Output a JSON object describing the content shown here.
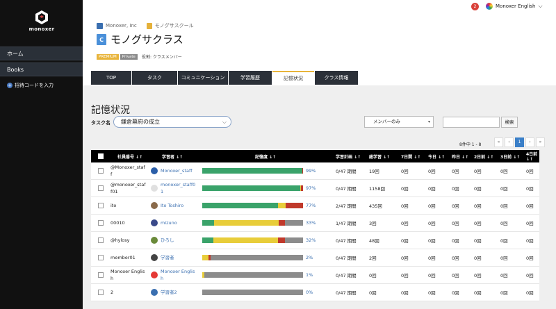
{
  "sidebar": {
    "logo_text": "monoxer",
    "items": [
      {
        "label": "ホーム"
      },
      {
        "label": "Books"
      }
    ],
    "invite_label": "招待コードを入力"
  },
  "topbar": {
    "notification_count": "2",
    "language_label": "Monoxer English"
  },
  "header": {
    "org_name": "Monoxer, Inc",
    "school_name": "モノグサスクール",
    "class_icon_letter": "C",
    "class_title": "モノグサクラス",
    "badge_premium": "PREMIUM",
    "badge_private": "Private",
    "role_text": "役割: クラスメンバー"
  },
  "tabs": [
    {
      "label": "TOP"
    },
    {
      "label": "タスク"
    },
    {
      "label": "コミュニケーション"
    },
    {
      "label": "学習履歴"
    },
    {
      "label": "記憶状況"
    },
    {
      "label": "クラス情報"
    }
  ],
  "active_tab_index": 4,
  "main": {
    "section_title": "記憶状況",
    "task_filter_label": "タスク名",
    "task_selected": "鎌倉幕府の成立",
    "member_filter": "メンバーのみ",
    "search_button": "検索",
    "pager_info": "8件中 1 - 8",
    "pager": [
      "«",
      "‹",
      "1",
      "›",
      "»"
    ]
  },
  "colors": {
    "green": "#3aa36a",
    "yellow": "#e8cd3a",
    "red": "#c0392b",
    "gray": "#8c8c8c",
    "link": "#3a6fb0",
    "accent": "#e8b43a"
  },
  "table": {
    "headers": [
      "社員番号 ↓↑",
      "学習者 ↓↑",
      "記憶度 ↓↑",
      "学習計画 ↓↑",
      "総学習 ↓↑",
      "7日間 ↓↑",
      "今日 ↓↑",
      "昨日 ↓↑",
      "2日前 ↓↑",
      "3日前 ↓↑",
      "4日前 ↓↑"
    ],
    "rows": [
      {
        "id": "@Monoxer_staf\nf",
        "learner": "Monoxer_staff",
        "avatar": "#2b5ea8",
        "mem": [
          99,
          0,
          1,
          0
        ],
        "pct": "99%",
        "plan": "0/47 期間",
        "total": "19回",
        "d7": "0回",
        "today": "0回",
        "yesterday": "0回",
        "d2": "0回",
        "d3": "0回",
        "d4": "0回"
      },
      {
        "id": "@monoxer_staf\nf01",
        "learner": "monoxer_staff0\n1",
        "avatar": "#e0e0e0",
        "mem": [
          97,
          1,
          2,
          0
        ],
        "pct": "97%",
        "plan": "0/47 期間",
        "total": "1158回",
        "d7": "0回",
        "today": "0回",
        "yesterday": "0回",
        "d2": "0回",
        "d3": "0回",
        "d4": "0回"
      },
      {
        "id": "ito",
        "learner": "Ito Toshiro",
        "avatar": "#8a6a4a",
        "mem": [
          75,
          8,
          17,
          0
        ],
        "pct": "77%",
        "plan": "2/47 期間",
        "total": "435回",
        "d7": "0回",
        "today": "0回",
        "yesterday": "0回",
        "d2": "0回",
        "d3": "0回",
        "d4": "0回"
      },
      {
        "id": "00010",
        "learner": "mizuno",
        "avatar": "#3a4a8a",
        "mem": [
          12,
          64,
          6,
          18
        ],
        "pct": "33%",
        "plan": "1/47 期間",
        "total": "3回",
        "d7": "0回",
        "today": "0回",
        "yesterday": "0回",
        "d2": "0回",
        "d3": "0回",
        "d4": "0回"
      },
      {
        "id": "@hylosy",
        "learner": "ひろし",
        "avatar": "#6a8a3a",
        "mem": [
          11,
          64,
          7,
          18
        ],
        "pct": "32%",
        "plan": "0/47 期間",
        "total": "48回",
        "d7": "0回",
        "today": "0回",
        "yesterday": "0回",
        "d2": "0回",
        "d3": "0回",
        "d4": "0回"
      },
      {
        "id": "member01",
        "learner": "学習者",
        "avatar": "#444444",
        "mem": [
          0,
          6,
          2,
          92
        ],
        "pct": "2%",
        "plan": "0/47 期間",
        "total": "2回",
        "d7": "0回",
        "today": "0回",
        "yesterday": "0回",
        "d2": "0回",
        "d3": "0回",
        "d4": "0回"
      },
      {
        "id": "Monoxer Englis\nh",
        "learner": "Monoxer Englis\nh",
        "avatar": "#e53935",
        "mem": [
          0,
          2,
          0,
          98
        ],
        "pct": "1%",
        "plan": "0/47 期間",
        "total": "0回",
        "d7": "0回",
        "today": "0回",
        "yesterday": "0回",
        "d2": "0回",
        "d3": "0回",
        "d4": "0回"
      },
      {
        "id": "2",
        "learner": "学習者2",
        "avatar": "#3a6fb0",
        "mem": [
          0,
          0,
          0,
          100
        ],
        "pct": "0%",
        "plan": "0/47 期間",
        "total": "0回",
        "d7": "0回",
        "today": "0回",
        "yesterday": "0回",
        "d2": "0回",
        "d3": "0回",
        "d4": "0回"
      }
    ]
  }
}
